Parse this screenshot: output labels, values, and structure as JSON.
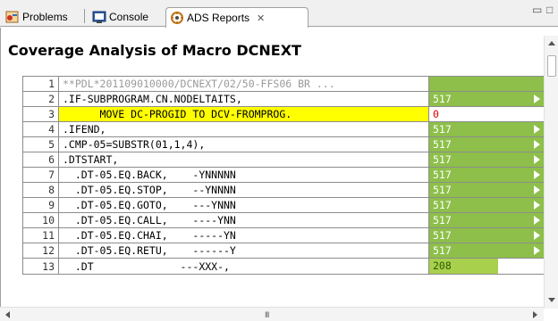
{
  "tabs": [
    {
      "label": "Problems",
      "icon": "problems-icon"
    },
    {
      "label": "Console",
      "icon": "console-icon"
    },
    {
      "label": "ADS Reports",
      "icon": "ads-reports-icon",
      "active": true,
      "close": "✕"
    }
  ],
  "window_controls": {
    "minimize": "▭",
    "maximize": "□"
  },
  "report": {
    "title": "Coverage Analysis of Macro DCNEXT",
    "rows": [
      {
        "n": "1",
        "src": "**PDL*201109010000/DCNEXT/02/50-FFS06 BR ...",
        "count": "",
        "kind": "comment"
      },
      {
        "n": "2",
        "src": ".IF-SUBPROGRAM.CN.NODELTAITS,",
        "count": "517",
        "kind": "branch"
      },
      {
        "n": "3",
        "src": "      MOVE DC-PROGID TO DCV-FROMPROG.",
        "count": "0",
        "kind": "uncovered"
      },
      {
        "n": "4",
        "src": ".IFEND,",
        "count": "517",
        "kind": "branch"
      },
      {
        "n": "5",
        "src": ".CMP-05=SUBSTR(01,1,4),",
        "count": "517",
        "kind": "branch"
      },
      {
        "n": "6",
        "src": ".DTSTART,",
        "count": "517",
        "kind": "branch"
      },
      {
        "n": "7",
        "src": "  .DT-05.EQ.BACK,    -YNNNNN",
        "count": "517",
        "kind": "branch"
      },
      {
        "n": "8",
        "src": "  .DT-05.EQ.STOP,    --YNNNN",
        "count": "517",
        "kind": "branch"
      },
      {
        "n": "9",
        "src": "  .DT-05.EQ.GOTO,    ---YNNN",
        "count": "517",
        "kind": "branch"
      },
      {
        "n": "10",
        "src": "  .DT-05.EQ.CALL,    ----YNN",
        "count": "517",
        "kind": "branch"
      },
      {
        "n": "11",
        "src": "  .DT-05.EQ.CHAI,    -----YN",
        "count": "517",
        "kind": "branch"
      },
      {
        "n": "12",
        "src": "  .DT-05.EQ.RETU,    ------Y",
        "count": "517",
        "kind": "branch"
      },
      {
        "n": "13",
        "src": "  .DT              ---XXX-,",
        "count": "208",
        "kind": "partial"
      }
    ]
  },
  "colors": {
    "covered": "#8dbf4a",
    "partial": "#a8d04c",
    "highlight": "#ffff00",
    "uncovered_text": "#e00000"
  },
  "scrollbar": {
    "h_grip": "III"
  }
}
